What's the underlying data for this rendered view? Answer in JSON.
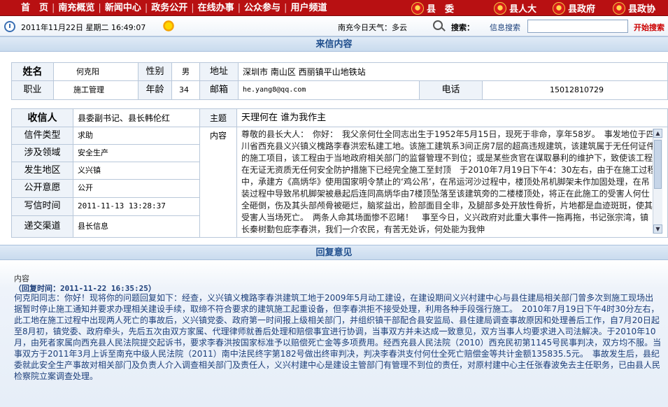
{
  "topnav": {
    "items": [
      "首　页",
      "南充概览",
      "新闻中心",
      "政务公开",
      "在线办事",
      "公众参与",
      "用户频道"
    ],
    "gov_links": [
      "县　委",
      "县人大",
      "县政府",
      "县政协"
    ]
  },
  "infobar": {
    "datetime": "2011年11月22日 星期二 16:49:07",
    "weather": "南充今日天气：多云",
    "search_label": "搜索：",
    "search_type": "信息搜索",
    "search_value": "",
    "search_button": "开始搜索"
  },
  "sections": {
    "letter_title": "来信内容",
    "reply_title": "回复意见"
  },
  "person": {
    "name_label": "姓名",
    "name_value": "何克阳",
    "gender_label": "性别",
    "gender_value": "男",
    "address_label": "地址",
    "address_value": "深圳市 南山区 西丽镇平山地铁站",
    "job_label": "职业",
    "job_value": "施工管理",
    "age_label": "年龄",
    "age_value": "34",
    "email_label": "邮箱",
    "email_value": "he.yang8@qq.com",
    "phone_label": "电话",
    "phone_value": "15012810729"
  },
  "letter": {
    "recipient_label": "收信人",
    "recipient_value": "县委副书记、县长韩伦红",
    "subject_label": "主题",
    "subject_value": "天理何在 谁为我作主",
    "type_label": "信件类型",
    "type_value": "求助",
    "field_label": "涉及领域",
    "field_value": "安全生产",
    "region_label": "发生地区",
    "region_value": "义兴镇",
    "public_label": "公开意愿",
    "public_value": "公开",
    "time_label": "写信时间",
    "time_value": "2011-11-13 13:28:37",
    "channel_label": "递交渠道",
    "channel_value": "县长信息",
    "content_label": "内容",
    "content_text": "尊敬的县长大人：　你好：　我父亲何仕全同志出生于1952年5月15日，现死于非命，享年58岁。　事发地位于四川省西充县义兴镇义槐路李春洪宏私建工地。该施工建筑系3间正房7层的超高违规建筑，该建筑属于无任何证件的施工项目，该工程由于当地政府相关部门的监督管理不到位；或是某些贪官在谋取暴利的维护下，致使该工程在无证无资质无任何安全防护措施下已经完全施工至封顶　于2010年7月19日下午4：30左右，由于在施工过程中，承建方《高炳华》使用国家明令禁止的‘鸡公吊’，在吊运河沙过程中，楼顶处吊机脚架未作加固处理，在吊装过程中导致吊机脚架被悬起后连同高炳华由7楼顶坠落至该建筑旁的二楼楼顶处，将正在此施工的受害人何仕全砸倒，伤及其头部颅骨被砸烂，脑浆益出，脸部面目全非，及腿部多处开放性骨折，片地都是血迹斑斑，使其受害人当场死亡。　两条人命其场面惨不忍睹！　事至今日，义兴政府对此重大事件一拖再拖，书记张宗湾，镇长秦树勤包庇李春洪，我们一介农民，有苦无处诉，何处能为我伸"
  },
  "reply": {
    "content_label": "内容",
    "time_line": "（回复时间：2011-11-22 16:35:25）",
    "text": "何克阳同志：你好！现将你的问题回复如下：经查，义兴镇义槐路李春洪建筑工地于2009年5月动工建设，在建设期间义兴村建中心与县住建局相关部门曾多次到施工现场出据暂时停止施工通知并要求办理相关建设手续，取缔不符合要求的建筑施工起重设备，但李春洪拒不接受处理，利用各种手段强行施工。　2010年7月19日下午4时30分左右，此工地在施工过程中出现两人死亡的事故后，义兴镇党委、政府第一时间报上级相关部门，并组织镇干部配合县安监局、县住建局调查事故原因和处理善后工作，自7月20日起至8月初，镇党委、政府牵头，先后五次由双方家属、代理律师就善后处理和赔偿事宜进行协调，当事双方并未达成一致意见，双方当事人均要求进入司法解决。于2010年10月，由死者家属向西充县人民法院提交起诉书，要求李春洪按国家标准予以赔偿死亡金等多项费用。经西充县人民法院（2010）西充民初第1145号民事判决，双方均不服。当事双方于2011年3月上诉至南充中级人民法院（2011）南中法民终字第182号做出终审判决，判决李春洪支付何仕全死亡赔偿金等共计金额135835.5元。　事故发生后，县纪委就此安全生产事故对相关部门及负责人介入调查相关部门及责任人，义兴村建中心是建设主管部门有管理不到位的责任，对原村建中心主任张春波免去主任职务，已由县人民检察院立案调查处理。"
  }
}
